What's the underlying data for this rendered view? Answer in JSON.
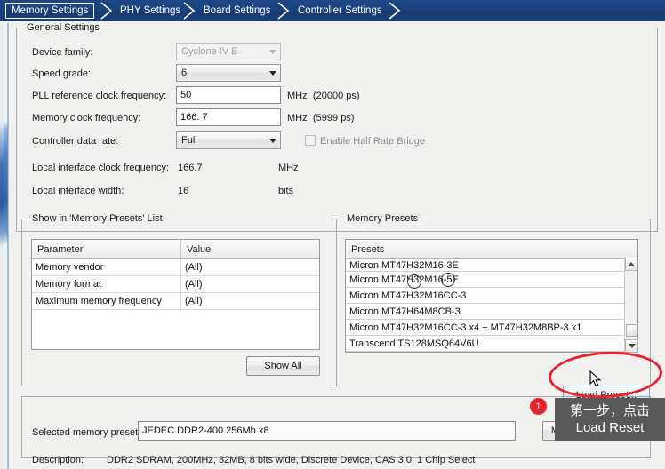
{
  "tabs": [
    {
      "label": "Memory Settings",
      "selected": true
    },
    {
      "label": "PHY Settings",
      "selected": false
    },
    {
      "label": "Board Settings",
      "selected": false
    },
    {
      "label": "Controller Settings",
      "selected": false
    }
  ],
  "general_settings": {
    "title": "General Settings",
    "device_family": {
      "label": "Device family:",
      "value": "Cyclone IV E",
      "disabled": true
    },
    "speed_grade": {
      "label": "Speed grade:",
      "value": "6"
    },
    "pll_ref_clock": {
      "label": "PLL reference clock frequency:",
      "value": "50",
      "unit": "MHz",
      "note": "(20000 ps)"
    },
    "memory_clock": {
      "label": "Memory clock frequency:",
      "value": "166. 7",
      "unit": "MHz",
      "note": "(5999 ps)"
    },
    "controller_data_rate": {
      "label": "Controller data rate:",
      "value": "Full"
    },
    "half_rate_bridge": {
      "label": "Enable Half Rate Bridge",
      "checked": false,
      "disabled": true
    },
    "local_if_clock": {
      "label": "Local interface clock frequency:",
      "value": "166.7",
      "unit": "MHz"
    },
    "local_if_width": {
      "label": "Local interface width:",
      "value": "16",
      "unit": "bits"
    }
  },
  "show_in_list": {
    "title": "Show in 'Memory Presets' List",
    "columns": [
      "Parameter",
      "Value"
    ],
    "rows": [
      {
        "parameter": "Memory vendor",
        "value": "(All)"
      },
      {
        "parameter": "Memory format",
        "value": "(All)"
      },
      {
        "parameter": "Maximum memory frequency",
        "value": "(All)"
      }
    ],
    "show_all_button": "Show All"
  },
  "memory_presets": {
    "title": "Memory Presets",
    "column_header": "Presets",
    "items": [
      "Micron MT47H32M16-3E",
      "Micron MT47H32M16-5E",
      "Micron MT47H32M16CC-3",
      "Micron MT47H64M8CB-3",
      "Micron MT47H32M16CC-3 x4 + MT47H32M8BP-3 x1",
      "Transcend TS128MSQ64V6U"
    ],
    "load_preset_button": "Load Preset..."
  },
  "footer": {
    "selected_preset_label": "Selected memory preset:",
    "selected_preset_value": "JEDEC DDR2-400 256Mb x8",
    "modify_parameters_button": "Modify parameters...",
    "description_label": "Description:",
    "description_value": "DDR2 SDRAM, 200MHz, 32MB, 8 bits wide, Discrete Device, CAS 3.0, 1 Chip Select"
  },
  "annotation": {
    "step_number": "1",
    "tooltip_line1": "第一步，点击",
    "tooltip_line2": "Load Reset",
    "highlight_color": "#e8222a"
  }
}
